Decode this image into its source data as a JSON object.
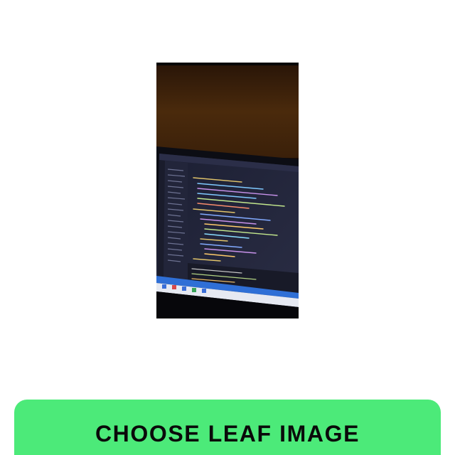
{
  "theme": {
    "accent": "#4cea79",
    "background": "#ffffff"
  },
  "preview": {
    "icon": "photo-of-laptop-code-editor"
  },
  "action": {
    "label": "CHOOSE LEAF IMAGE"
  }
}
